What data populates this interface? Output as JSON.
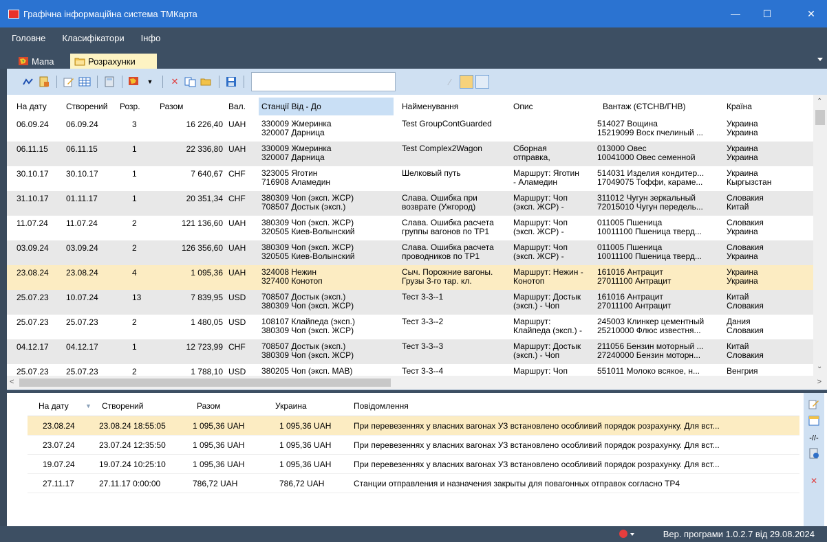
{
  "window": {
    "title": "Графічна інформаційна система ТМКарта",
    "app_icon_text": "ТМК"
  },
  "menu": [
    "Головне",
    "Класифікатори",
    "Інфо"
  ],
  "tabs": [
    {
      "label": "Мапа",
      "active": false
    },
    {
      "label": "Розрахунки",
      "active": true
    }
  ],
  "grid": {
    "headers": [
      "На дату",
      "Створений",
      "Розр.",
      "Разом",
      "Вал.",
      "Станції Від - До",
      "Найменування",
      "Опис",
      "Вантаж (ЄТСНВ/ГНВ)",
      "Країна"
    ],
    "rows": [
      {
        "date": "06.09.24",
        "created": "06.09.24",
        "calc": "3",
        "total": "16 226,40",
        "cur": "UAH",
        "st1": "330009  Жмеринка",
        "st2": "320007  Дарница",
        "name1": "Test GroupContGuarded",
        "name2": "",
        "desc1": "",
        "desc2": "",
        "cargo1": "514027  Вощина",
        "cargo2": "15219099  Воск пчелиный ...",
        "country1": "Украина",
        "country2": "Украина"
      },
      {
        "date": "06.11.15",
        "created": "06.11.15",
        "calc": "1",
        "total": "22 336,80",
        "cur": "UAH",
        "st1": "330009  Жмеринка",
        "st2": "320007  Дарница",
        "name1": "Test Complex2Wagon",
        "name2": "",
        "desc1": "Сборная",
        "desc2": "отправка,",
        "cargo1": "013000  Овес",
        "cargo2": "10041000  Овес семенной",
        "country1": "Украина",
        "country2": "Украина"
      },
      {
        "date": "30.10.17",
        "created": "30.10.17",
        "calc": "1",
        "total": "7 640,67",
        "cur": "CHF",
        "st1": "323005  Яготин",
        "st2": "716908  Аламедин",
        "name1": "Шелковый путь",
        "name2": "",
        "desc1": "Маршрут: Яготин",
        "desc2": "- Аламедин",
        "cargo1": "514031  Изделия кондитер...",
        "cargo2": "17049075  Тоффи, карамe...",
        "country1": "Украина",
        "country2": "Кыргызстан"
      },
      {
        "date": "31.10.17",
        "created": "01.11.17",
        "calc": "1",
        "total": "20 351,34",
        "cur": "CHF",
        "st1": "380309  Чоп (эксп. ЖСР)",
        "st2": "708507  Достык (эксп.)",
        "name1": "Слава. Ошибка при",
        "name2": "возврате (Ужгород)",
        "desc1": "Маршрут: Чоп",
        "desc2": "(эксп. ЖСР) -",
        "cargo1": "311012  Чугун зеркальный",
        "cargo2": "72015010  Чугун передель...",
        "country1": "Словакия",
        "country2": "Китай"
      },
      {
        "date": "11.07.24",
        "created": "11.07.24",
        "calc": "2",
        "total": "121 136,60",
        "cur": "UAH",
        "st1": "380309  Чоп (эксп. ЖСР)",
        "st2": "320505  Киев-Волынский",
        "name1": "Слава. Ошибка расчета",
        "name2": "группы вагонов по ТР1",
        "desc1": "Маршрут: Чоп",
        "desc2": "(эксп. ЖСР) -",
        "cargo1": "011005  Пшеница",
        "cargo2": "10011100  Пшеница тверд...",
        "country1": "Словакия",
        "country2": "Украина"
      },
      {
        "date": "03.09.24",
        "created": "03.09.24",
        "calc": "2",
        "total": "126 356,60",
        "cur": "UAH",
        "st1": "380309  Чоп (эксп. ЖСР)",
        "st2": "320505  Киев-Волынский",
        "name1": "Слава. Ошибка расчета",
        "name2": "проводников по ТР1",
        "desc1": "Маршрут: Чоп",
        "desc2": "(эксп. ЖСР) -",
        "cargo1": "011005  Пшеница",
        "cargo2": "10011100  Пшеница тверд...",
        "country1": "Словакия",
        "country2": "Украина"
      },
      {
        "date": "23.08.24",
        "created": "23.08.24",
        "calc": "4",
        "total": "1 095,36",
        "cur": "UAH",
        "st1": "324008  Нежин",
        "st2": "327400  Конотоп",
        "name1": "Сыч. Порожние вагоны.",
        "name2": "Грузы 3-го тар. кл.",
        "desc1": "Маршрут: Нежин -",
        "desc2": "Конотоп",
        "cargo1": "161016  Антрацит",
        "cargo2": "27011100  Антрацит",
        "country1": "Украина",
        "country2": "Украина"
      },
      {
        "date": "25.07.23",
        "created": "10.07.24",
        "calc": "13",
        "total": "7 839,95",
        "cur": "USD",
        "st1": "708507  Достык (эксп.)",
        "st2": "380309  Чоп (эксп. ЖСР)",
        "name1": "Тест 3-3--1",
        "name2": "",
        "desc1": "Маршрут: Достык",
        "desc2": "(эксп.) - Чоп",
        "cargo1": "161016  Антрацит",
        "cargo2": "27011100  Антрацит",
        "country1": "Китай",
        "country2": "Словакия"
      },
      {
        "date": "25.07.23",
        "created": "25.07.23",
        "calc": "2",
        "total": "1 480,05",
        "cur": "USD",
        "st1": "108107  Клайпеда (эксп.)",
        "st2": "380309  Чоп (эксп. ЖСР)",
        "name1": "Тест 3-3--2",
        "name2": "",
        "desc1": "Маршрут:",
        "desc2": "Клайпеда (эксп.) -",
        "cargo1": "245003  Клинкер цементный",
        "cargo2": "25210000  Флюс известня...",
        "country1": "Дания",
        "country2": "Словакия"
      },
      {
        "date": "04.12.17",
        "created": "04.12.17",
        "calc": "1",
        "total": "12 723,99",
        "cur": "CHF",
        "st1": "708507  Достык (эксп.)",
        "st2": "380309  Чоп (эксп. ЖСР)",
        "name1": "Тест 3-3--3",
        "name2": "",
        "desc1": "Маршрут: Достык",
        "desc2": "(эксп.) - Чоп",
        "cargo1": "211056  Бензин моторный ...",
        "cargo2": "27240000  Бензин моторн...",
        "country1": "Китай",
        "country2": "Словакия"
      },
      {
        "date": "25.07.23",
        "created": "25.07.23",
        "calc": "2",
        "total": "1 788,10",
        "cur": "USD",
        "st1": "380205  Чоп (эксп. МАВ)",
        "st2": "",
        "name1": "Тест 3-3--4",
        "name2": "",
        "desc1": "Маршрут: Чоп",
        "desc2": "",
        "cargo1": "551011  Молоко всякое, н...",
        "cargo2": "",
        "country1": "Венгрия",
        "country2": ""
      }
    ]
  },
  "bottom": {
    "headers": [
      "На дату",
      "Створений",
      "Разом",
      "Украина",
      "Повідомлення"
    ],
    "rows": [
      {
        "date": "23.08.24",
        "created": "23.08.24 18:55:05",
        "total": "1 095,36 UAH",
        "ua": "1 095,36 UAH",
        "msg": "При перевезеннях у власних вагонах УЗ встановлено особливий порядок розрахунку. Для вст..."
      },
      {
        "date": "23.07.24",
        "created": "23.07.24 12:35:50",
        "total": "1 095,36 UAH",
        "ua": "1 095,36 UAH",
        "msg": "При перевезеннях у власних вагонах УЗ встановлено особливий порядок розрахунку. Для вст..."
      },
      {
        "date": "19.07.24",
        "created": "19.07.24 10:25:10",
        "total": "1 095,36 UAH",
        "ua": "1 095,36 UAH",
        "msg": "При перевезеннях у власних вагонах УЗ встановлено особливий порядок розрахунку. Для вст..."
      },
      {
        "date": "27.11.17",
        "created": "27.11.17 0:00:00",
        "total": "786,72 UAH",
        "ua": "786,72 UAH",
        "msg": "Станции отправления и назначения закрыты для повагонных отправок согласно ТР4"
      }
    ],
    "side_label": "-//-"
  },
  "status": {
    "version": "Вер. програми 1.0.2.7 від 29.08.2024"
  },
  "colors": {
    "titlebar": "#2b73d1",
    "chrome": "#3d4f63",
    "toolbar": "#cfe0f2",
    "selected_row": "#fcecc2",
    "alt_row": "#e8e8e8"
  }
}
